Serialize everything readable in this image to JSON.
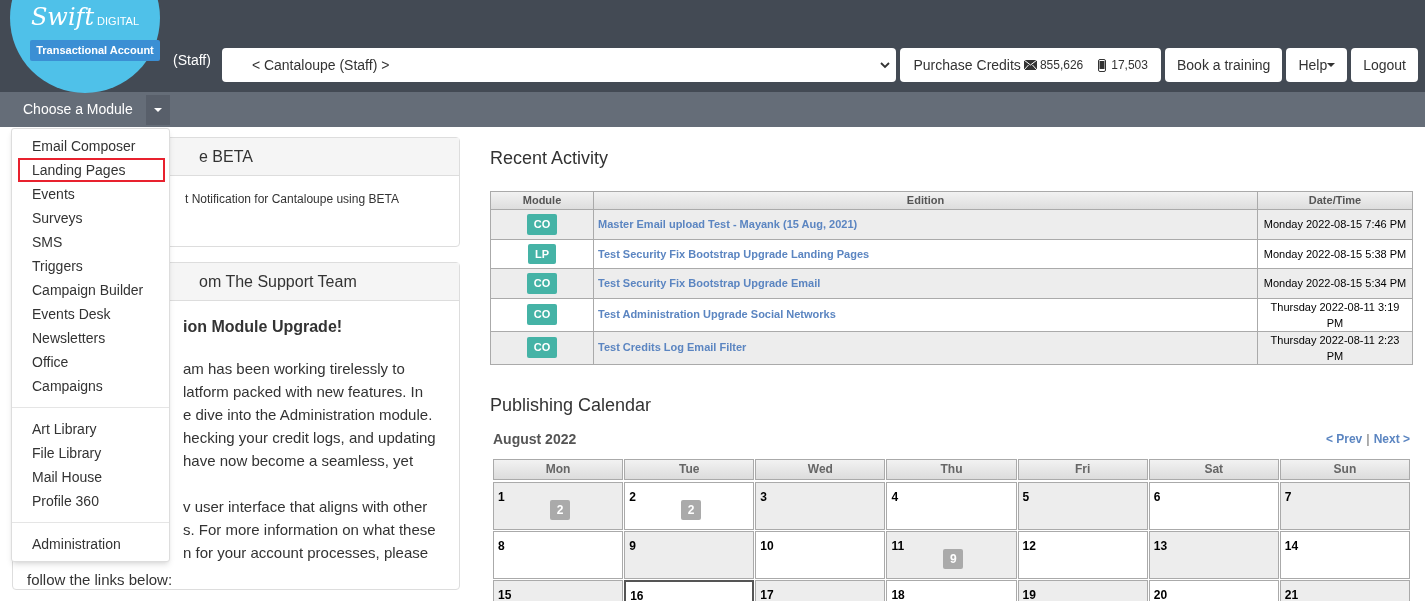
{
  "header": {
    "logo_script": "Swift",
    "logo_word": "DIGITAL",
    "account_badge": "Transactional Account",
    "role": "(Staff)",
    "account_select": "< Cantaloupe (Staff) >",
    "purchase": {
      "label": "Purchase Credits",
      "email_credits": "855,626",
      "sms_credits": "17,503"
    },
    "buttons": [
      {
        "label": "Book a training",
        "kind": "plain"
      },
      {
        "label": "Help",
        "kind": "dropdown"
      },
      {
        "label": "Logout",
        "kind": "plain"
      }
    ]
  },
  "nav": {
    "module_button": "Choose a Module",
    "expanded": true
  },
  "module_menu": [
    [
      {
        "label": "Email Composer",
        "selected": false
      },
      {
        "label": "Landing Pages",
        "selected": true
      },
      {
        "label": "Events",
        "selected": false
      },
      {
        "label": "Surveys",
        "selected": false
      },
      {
        "label": "SMS",
        "selected": false
      },
      {
        "label": "Triggers",
        "selected": false
      },
      {
        "label": "Campaign Builder",
        "selected": false
      },
      {
        "label": "Events Desk",
        "selected": false
      },
      {
        "label": "Newsletters",
        "selected": false
      },
      {
        "label": "Office",
        "selected": false
      },
      {
        "label": "Campaigns",
        "selected": false
      }
    ],
    [
      {
        "label": "Art Library",
        "selected": false
      },
      {
        "label": "File Library",
        "selected": false
      },
      {
        "label": "Mail House",
        "selected": false
      },
      {
        "label": "Profile 360",
        "selected": false
      }
    ],
    [
      {
        "label": "Administration",
        "selected": false
      }
    ]
  ],
  "panels": [
    {
      "title": "e BETA",
      "lines": [
        "t Notification for Cantaloupe using BETA"
      ]
    },
    {
      "title": "om The Support Team",
      "heading": "ion Module Upgrade!",
      "paragraphs": [
        [
          "am has been working tirelessly to",
          "latform packed with new features. In",
          "e dive into the Administration module.",
          "hecking your credit logs, and updating",
          "have now become a seamless, yet"
        ],
        [
          "v user interface that aligns with other",
          "s. For more information on what these",
          "n for your account processes, please"
        ]
      ],
      "footer": "follow the links below:"
    }
  ],
  "recent_activity": {
    "title": "Recent Activity",
    "columns": [
      "Module",
      "Edition",
      "Date/Time"
    ],
    "rows": [
      {
        "module": "CO",
        "edition": "Master Email upload Test - Mayank (15 Aug, 2021)",
        "datetime": "Monday 2022-08-15 7:46 PM"
      },
      {
        "module": "LP",
        "edition": "Test Security Fix Bootstrap Upgrade Landing Pages",
        "datetime": "Monday 2022-08-15 5:38 PM"
      },
      {
        "module": "CO",
        "edition": "Test Security Fix Bootstrap Upgrade Email",
        "datetime": "Monday 2022-08-15 5:34 PM"
      },
      {
        "module": "CO",
        "edition": "Test Administration Upgrade Social Networks",
        "datetime": "Thursday 2022-08-11 3:19 PM"
      },
      {
        "module": "CO",
        "edition": "Test Credits Log Email Filter",
        "datetime": "Thursday 2022-08-11 2:23 PM"
      }
    ]
  },
  "calendar": {
    "title": "Publishing Calendar",
    "month": "August 2022",
    "prev": "< Prev",
    "separator": "|",
    "next": "Next >",
    "weekdays": [
      "Mon",
      "Tue",
      "Wed",
      "Thu",
      "Fri",
      "Sat",
      "Sun"
    ],
    "weeks": [
      [
        {
          "day": "1",
          "count": "2",
          "today": false
        },
        {
          "day": "2",
          "count": "2",
          "today": false
        },
        {
          "day": "3",
          "today": false
        },
        {
          "day": "4",
          "today": false
        },
        {
          "day": "5",
          "today": false
        },
        {
          "day": "6",
          "today": false
        },
        {
          "day": "7",
          "today": false
        }
      ],
      [
        {
          "day": "8",
          "today": false
        },
        {
          "day": "9",
          "today": false
        },
        {
          "day": "10",
          "today": false
        },
        {
          "day": "11",
          "count": "9",
          "today": false
        },
        {
          "day": "12",
          "today": false
        },
        {
          "day": "13",
          "today": false
        },
        {
          "day": "14",
          "today": false
        }
      ],
      [
        {
          "day": "15",
          "today": false
        },
        {
          "day": "16",
          "today": true
        },
        {
          "day": "17",
          "today": false
        },
        {
          "day": "18",
          "today": false
        },
        {
          "day": "19",
          "today": false
        },
        {
          "day": "20",
          "today": false
        },
        {
          "day": "21",
          "today": false
        }
      ]
    ]
  }
}
